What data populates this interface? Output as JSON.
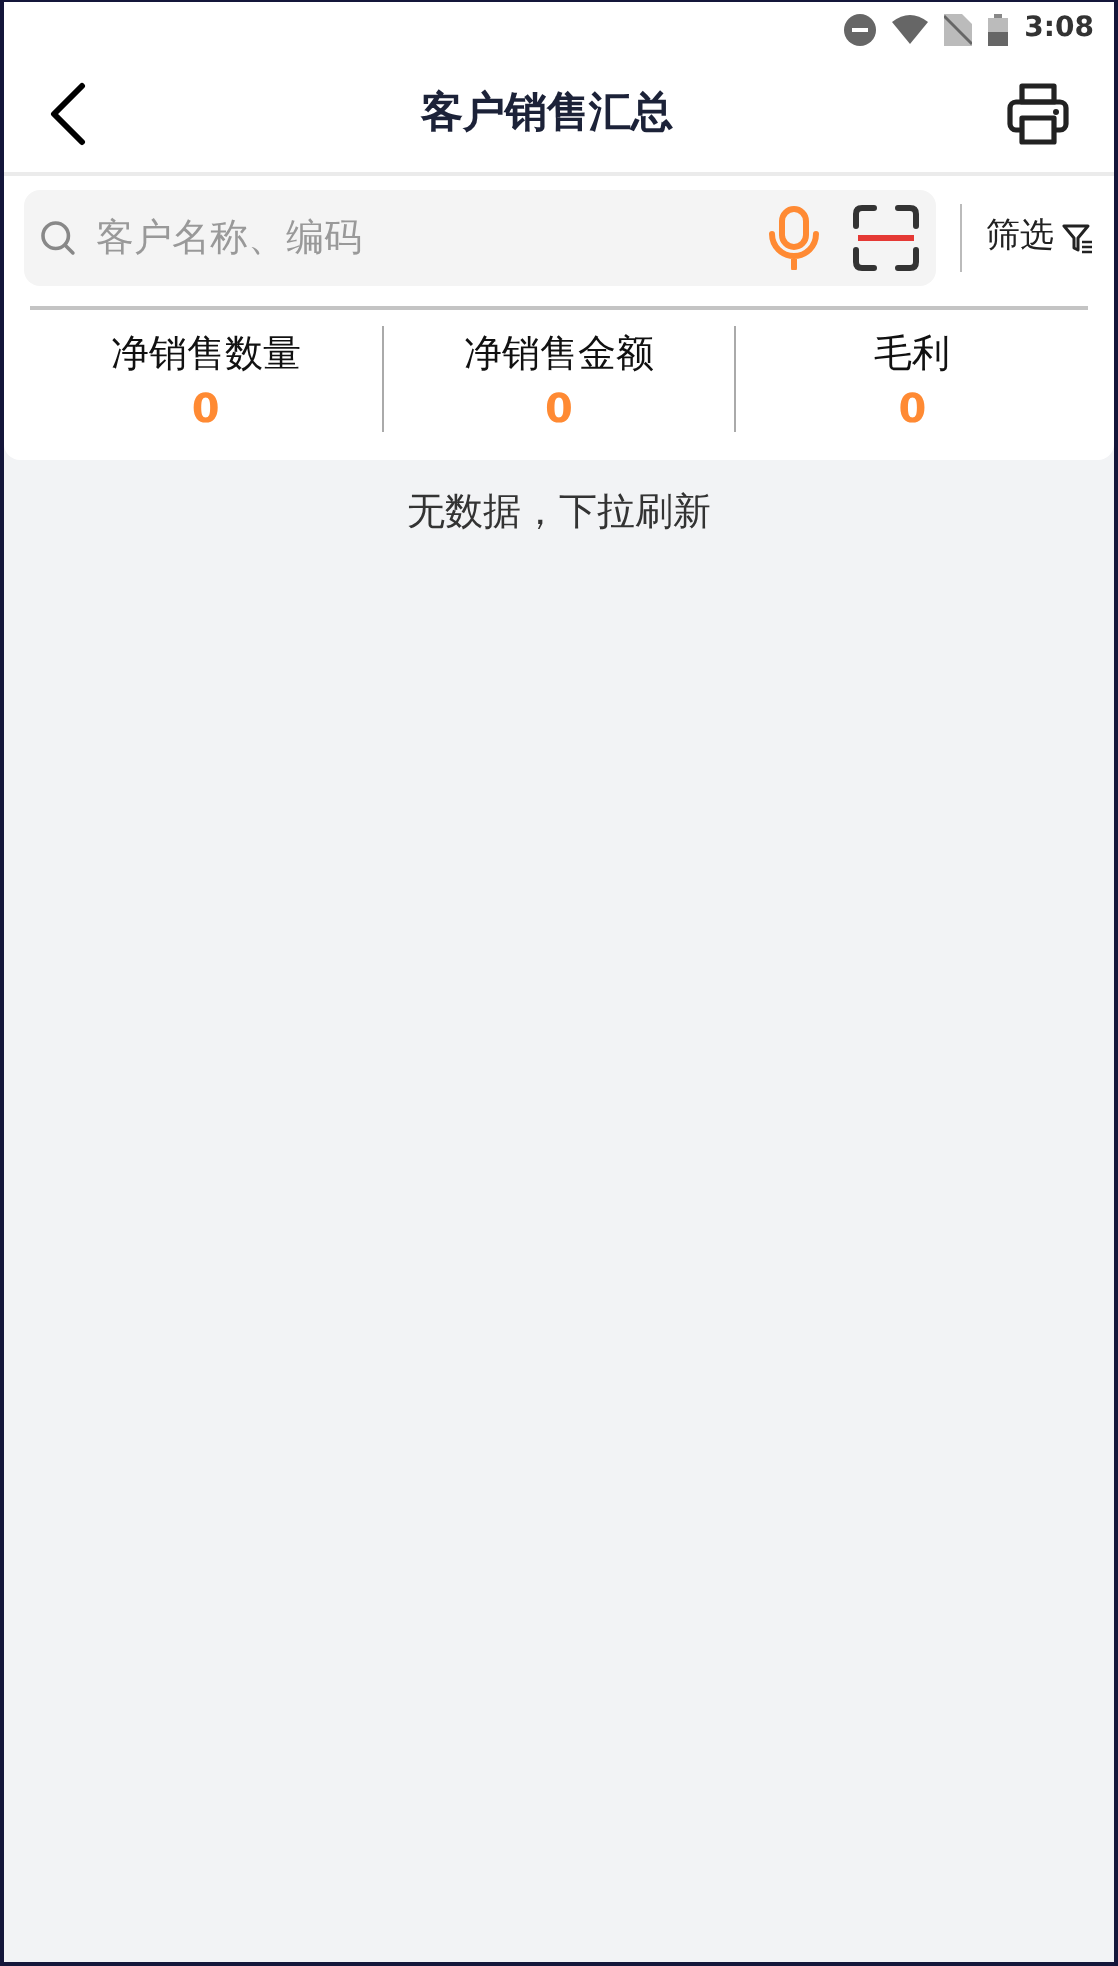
{
  "status_bar": {
    "time": "3:08"
  },
  "header": {
    "title": "客户销售汇总"
  },
  "search": {
    "placeholder": "客户名称、编码"
  },
  "filter": {
    "label": "筛选"
  },
  "stats": [
    {
      "label": "净销售数量",
      "value": "0"
    },
    {
      "label": "净销售金额",
      "value": "0"
    },
    {
      "label": "毛利",
      "value": "0"
    }
  ],
  "empty_message": "无数据，下拉刷新"
}
